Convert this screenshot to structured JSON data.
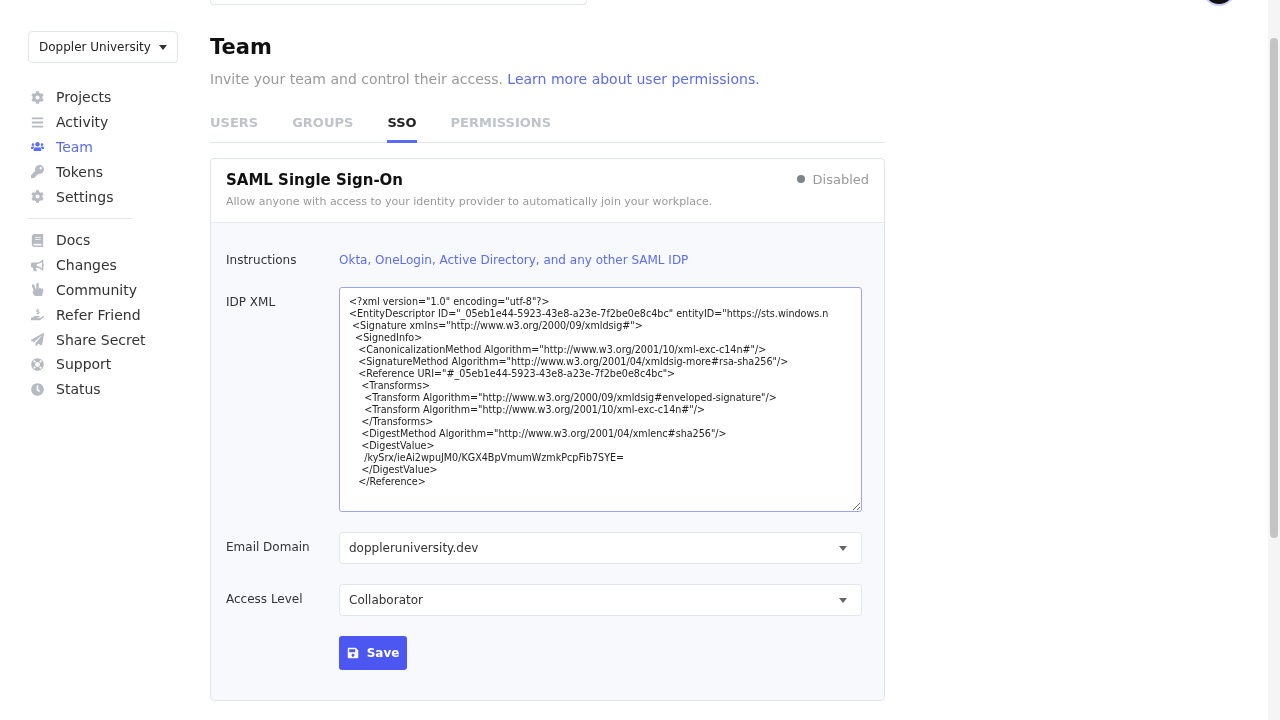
{
  "workplace": {
    "name": "Doppler University"
  },
  "nav": [
    {
      "label": "Projects",
      "selected": false
    },
    {
      "label": "Activity",
      "selected": false
    },
    {
      "label": "Team",
      "selected": true
    },
    {
      "label": "Tokens",
      "selected": false
    },
    {
      "label": "Settings",
      "selected": false
    }
  ],
  "nav_secondary": [
    {
      "label": "Docs"
    },
    {
      "label": "Changes"
    },
    {
      "label": "Community"
    },
    {
      "label": "Refer Friend"
    },
    {
      "label": "Share Secret"
    },
    {
      "label": "Support"
    },
    {
      "label": "Status"
    }
  ],
  "page": {
    "title": "Team",
    "subtitle": "Invite your team and control their access.",
    "subtitle_link": "Learn more about user permissions."
  },
  "tabs": [
    {
      "label": "USERS",
      "selected": false
    },
    {
      "label": "GROUPS",
      "selected": false
    },
    {
      "label": "SSO",
      "selected": true
    },
    {
      "label": "PERMISSIONS",
      "selected": false
    }
  ],
  "card": {
    "title": "SAML Single Sign-On",
    "status": "Disabled",
    "enabled": false,
    "description": "Allow anyone with access to your identity provider to automatically join your workplace.",
    "instructions_label": "Instructions",
    "instructions_link": "Okta, OneLogin, Active Directory, and any other SAML IDP",
    "xml_label": "IDP XML",
    "xml_lines": [
      "<?xml version=\"1.0\" encoding=\"utf-8\"?>",
      "<EntityDescriptor ID=\"_05eb1e44-5923-43e8-a23e-7f2be0e8c4bc\" entityID=\"https://sts.windows.n",
      " <Signature xmlns=\"http://www.w3.org/2000/09/xmldsig#\">",
      "  <SignedInfo>",
      "   <CanonicalizationMethod Algorithm=\"http://www.w3.org/2001/10/xml-exc-c14n#\"/>",
      "   <SignatureMethod Algorithm=\"http://www.w3.org/2001/04/xmldsig-more#rsa-sha256\"/>",
      "   <Reference URI=\"#_05eb1e44-5923-43e8-a23e-7f2be0e8c4bc\">",
      "    <Transforms>",
      "     <Transform Algorithm=\"http://www.w3.org/2000/09/xmldsig#enveloped-signature\"/>",
      "     <Transform Algorithm=\"http://www.w3.org/2001/10/xml-exc-c14n#\"/>",
      "    </Transforms>",
      "    <DigestMethod Algorithm=\"http://www.w3.org/2001/04/xmlenc#sha256\"/>",
      "    <DigestValue>",
      "     /kySrx/ieAi2wpuJM0/KGX4BpVmumWzmkPcpFib7SYE=",
      "    </DigestValue>",
      "   </Reference>"
    ],
    "email_label": "Email Domain",
    "email_value": "doppleruniversity.dev",
    "access_label": "Access Level",
    "access_value": "Collaborator",
    "save": "Save"
  }
}
